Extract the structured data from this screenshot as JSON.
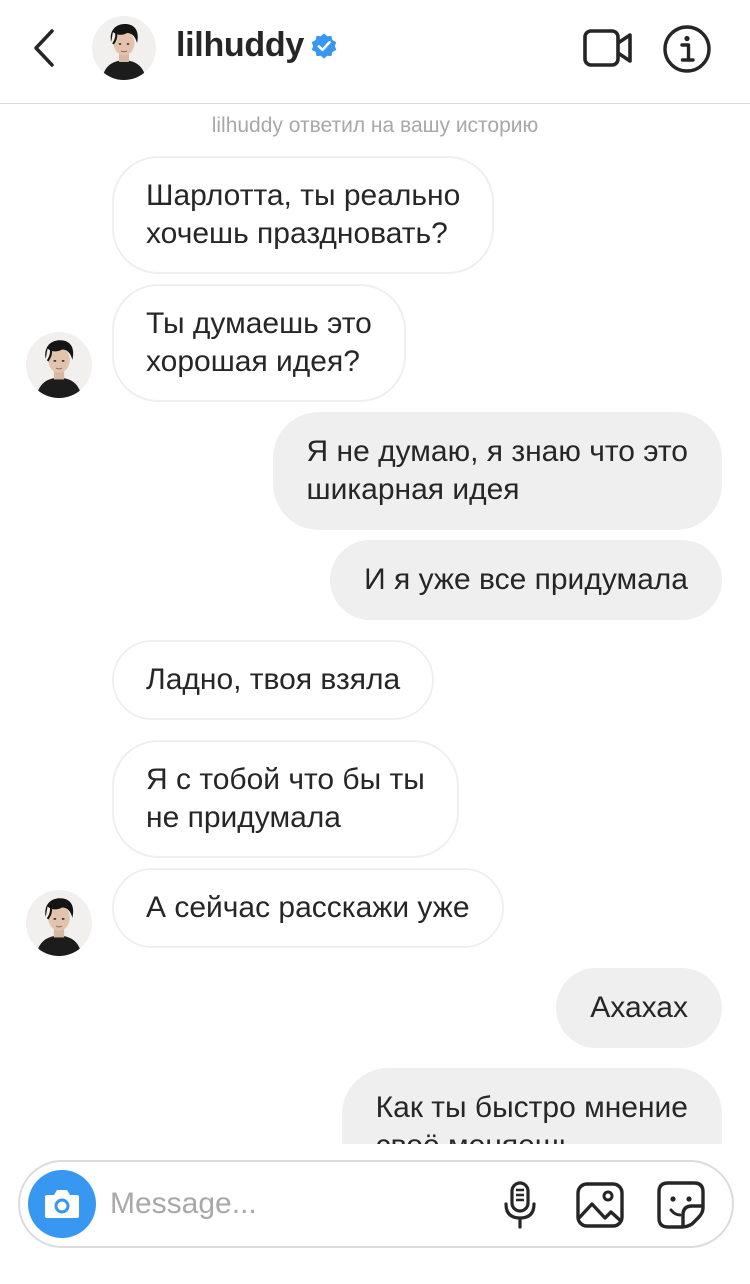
{
  "header": {
    "username": "lilhuddy",
    "verified": true,
    "icons": {
      "back": "chevron-left-icon",
      "video": "video-camera-icon",
      "info": "info-icon"
    }
  },
  "chat": {
    "story_reply_note": "lilhuddy ответил на вашу историю",
    "messages": [
      {
        "from": "them",
        "text": "Шарлотта, ты реально\nхочешь праздновать?"
      },
      {
        "from": "them",
        "text": "Ты думаешь это\nхорошая идея?"
      },
      {
        "from": "me",
        "text": "Я не думаю, я знаю что это\nшикарная идея"
      },
      {
        "from": "me",
        "text": "И я уже все придумала"
      },
      {
        "from": "them",
        "text": "Ладно, твоя взяла"
      },
      {
        "from": "them",
        "text": "Я с тобой что бы ты\nне придумала"
      },
      {
        "from": "them",
        "text": "А сейчас расскажи уже"
      },
      {
        "from": "me",
        "text": "Ахахах"
      },
      {
        "from": "me",
        "text": "Как ты быстро мнение\nсвоё меняешь"
      }
    ]
  },
  "composer": {
    "placeholder": "Message...",
    "value": "",
    "icons": {
      "camera": "camera-icon",
      "mic": "microphone-icon",
      "gallery": "gallery-icon",
      "sticker": "sticker-icon"
    }
  },
  "colors": {
    "accent": "#3897f0",
    "verified_badge": "#3897f0",
    "outgoing_bubble": "#efefef",
    "incoming_border": "#efefef",
    "muted_text": "#a8a8a8"
  }
}
